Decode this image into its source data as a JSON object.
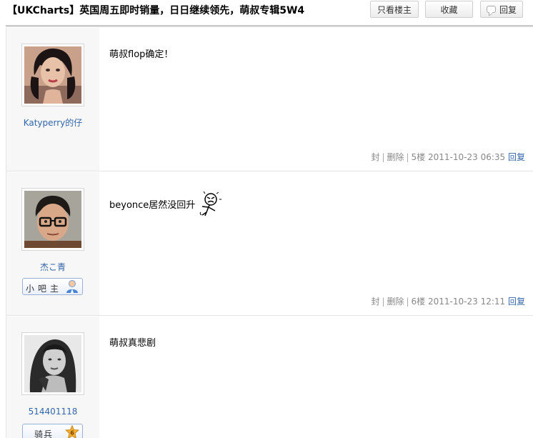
{
  "header": {
    "title": "【UKCharts】英国周五即时销量，日日继续领先，萌叔专辑5W4",
    "only_op_label": "只看楼主",
    "favorite_label": "收藏",
    "reply_label": "回复"
  },
  "posts": [
    {
      "username": "Katyperry的仔",
      "content": "萌叔flop确定！",
      "actions": {
        "block": "封",
        "delete": "删除"
      },
      "floor": "5楼",
      "time": "2011-10-23 06:35",
      "reply": "回复"
    },
    {
      "username": "杰こ青",
      "badge": "小吧主",
      "content": "beyonce居然没回升",
      "actions": {
        "block": "封",
        "delete": "删除"
      },
      "floor": "6楼",
      "time": "2011-10-23 12:11",
      "reply": "回复"
    },
    {
      "username": "514401118",
      "badge": "骑兵",
      "badge_level": "6",
      "content": "萌叔真悲剧"
    }
  ],
  "colors": {
    "link": "#3366aa",
    "sidebar": "#f7f7f7"
  }
}
